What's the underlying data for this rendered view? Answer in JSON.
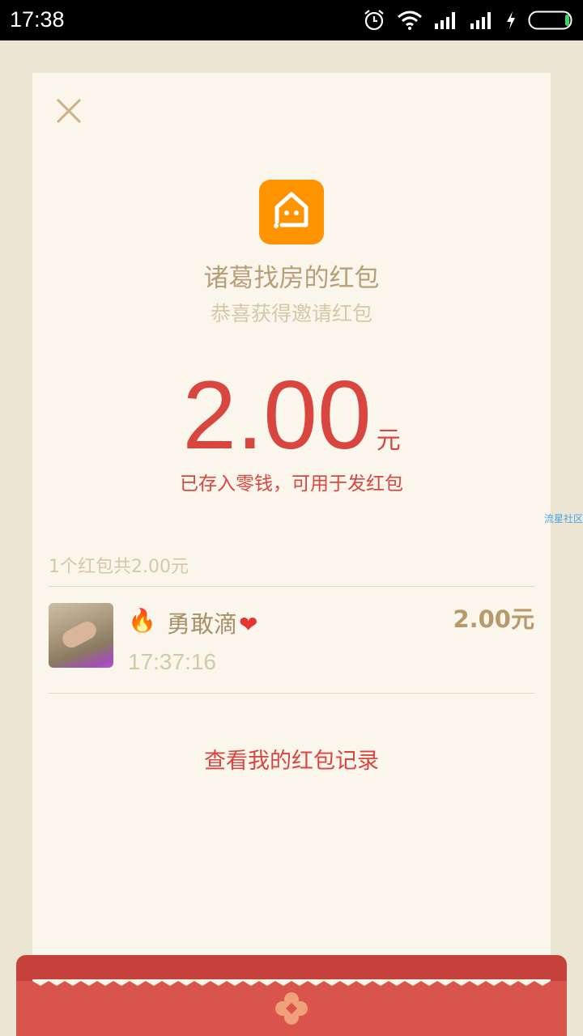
{
  "status_bar": {
    "time": "17:38",
    "icons": [
      "alarm-icon",
      "wifi-icon",
      "signal-icon",
      "signal-icon",
      "charging-icon",
      "battery-icon"
    ]
  },
  "packet": {
    "close_icon": "close-icon",
    "app_logo_icon": "house-logo-icon",
    "sender": "诸葛找房的红包",
    "greeting": "恭喜获得邀请红包",
    "amount": "2.00",
    "amount_unit": "元",
    "saved_note": "已存入零钱，可用于发红包",
    "watermark": "流星社区"
  },
  "summary": "1个红包共2.00元",
  "records": [
    {
      "nickname": "勇敢滴",
      "prefix_icon": "fire-icon",
      "suffix_icon": "heart-icon",
      "time": "17:37:16",
      "amount": "2.00元"
    }
  ],
  "history_link": "查看我的红包记录",
  "colors": {
    "accent_red": "#d9453f",
    "logo_orange": "#ff9300",
    "card_bg": "#faf6ec",
    "page_bg": "#ece5d4"
  }
}
